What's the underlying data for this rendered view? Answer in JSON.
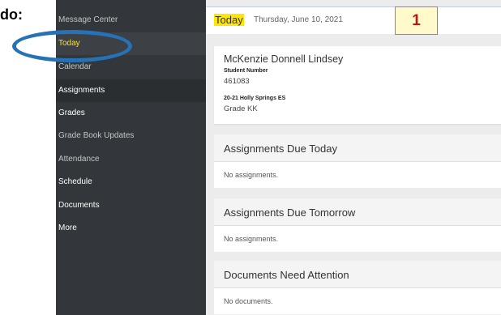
{
  "instruction_label": "do:",
  "sidebar": {
    "items": [
      {
        "label": "Message Center"
      },
      {
        "label": "Today"
      },
      {
        "label": "Calendar"
      },
      {
        "label": "Assignments"
      },
      {
        "label": "Grades"
      },
      {
        "label": "Grade Book Updates"
      },
      {
        "label": "Attendance"
      },
      {
        "label": "Schedule"
      },
      {
        "label": "Documents"
      },
      {
        "label": "More"
      }
    ]
  },
  "header": {
    "title": "Today",
    "date": "Thursday, June 10, 2021"
  },
  "annotation": {
    "step_number": "1",
    "callout_color": "#2672b7",
    "highlight_color": "#ffe600"
  },
  "student": {
    "name": "McKenzie Donnell Lindsey",
    "number_label": "Student Number",
    "number": "461083",
    "school": "20-21 Holly Springs ES",
    "grade": "Grade KK"
  },
  "sections": [
    {
      "title": "Assignments Due Today",
      "note": "No assignments."
    },
    {
      "title": "Assignments Due Tomorrow",
      "note": "No assignments."
    },
    {
      "title": "Documents Need Attention",
      "note": "No documents."
    }
  ]
}
